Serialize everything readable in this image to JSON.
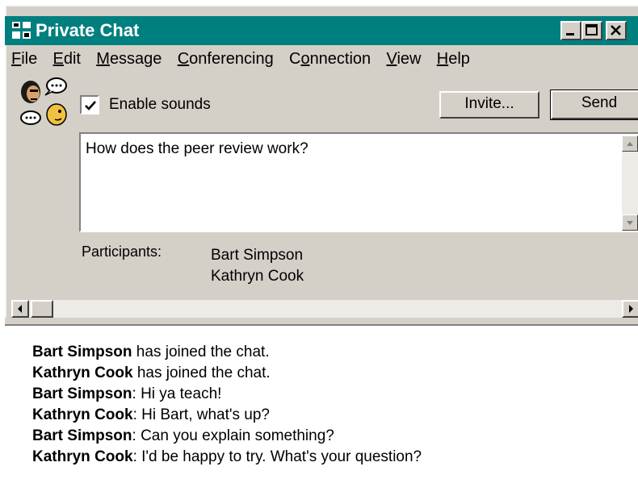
{
  "window": {
    "title": "Private Chat",
    "controls": [
      "minimize-icon",
      "maximize-icon",
      "close-icon"
    ]
  },
  "menu": {
    "items": [
      {
        "label": "File",
        "accel": "F",
        "rest": "ile"
      },
      {
        "label": "Edit",
        "accel": "E",
        "rest": "dit"
      },
      {
        "label": "Message",
        "accel": "M",
        "rest": "essage"
      },
      {
        "label": "Conferencing",
        "accel": "C",
        "rest": "onferencing"
      },
      {
        "label": "Connection",
        "pre": "C",
        "accel": "o",
        "rest": "nnection"
      },
      {
        "label": "View",
        "accel": "V",
        "rest": "iew"
      },
      {
        "label": "Help",
        "accel": "H",
        "rest": "elp"
      }
    ]
  },
  "toolbar": {
    "enable_sounds_label": "Enable sounds",
    "enable_sounds_checked": true,
    "invite_label": "Invite...",
    "send_label": "Send"
  },
  "compose": {
    "value": "How does the peer review work?"
  },
  "participants": {
    "label": "Participants:",
    "names": [
      "Bart Simpson",
      "Kathryn Cook"
    ]
  },
  "chat_log": [
    {
      "who": "Bart Simpson",
      "text": " has joined the chat."
    },
    {
      "who": "Kathryn Cook",
      "text": " has joined the chat."
    },
    {
      "who": "Bart Simpson",
      "text": ": Hi ya teach!"
    },
    {
      "who": "Kathryn Cook",
      "text": ": Hi Bart, what's up?"
    },
    {
      "who": "Bart Simpson",
      "text": ": Can you explain something?"
    },
    {
      "who": "Kathryn Cook",
      "text": ": I'd be happy to try.  What's your question?"
    }
  ],
  "colors": {
    "titlebar": "#007f7f",
    "face": "#d4d0c8"
  }
}
